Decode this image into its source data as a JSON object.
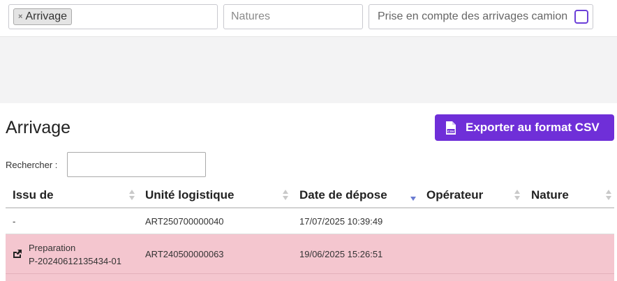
{
  "filters": {
    "type_chip": "Arrivage",
    "type_chip_remove": "×",
    "natures_placeholder": "Natures",
    "camion_label": "Prise en compte des arrivages camion",
    "camion_checked": false
  },
  "page": {
    "title": "Arrivage",
    "export_label": "Exporter au format CSV"
  },
  "search": {
    "label": "Rechercher :",
    "value": ""
  },
  "table": {
    "columns": [
      {
        "label": "Issu de",
        "sort": "none"
      },
      {
        "label": "Unité logistique",
        "sort": "none"
      },
      {
        "label": "Date de dépose",
        "sort": "desc"
      },
      {
        "label": "Opérateur",
        "sort": "none"
      },
      {
        "label": "Nature",
        "sort": "none"
      }
    ],
    "rows": [
      {
        "issu_de": "-",
        "unite": "ART250700000040",
        "date": "17/07/2025 10:39:49",
        "operateur": "",
        "nature": ""
      },
      {
        "issu_de_line1": "Preparation",
        "issu_de_line2": "P-20240612135434-01",
        "unite": "ART240500000063",
        "date": "19/06/2025 15:26:51",
        "operateur": "",
        "nature": ""
      }
    ]
  },
  "colors": {
    "accent": "#6f2fd8",
    "highlight_row": "#f4c6cf"
  }
}
